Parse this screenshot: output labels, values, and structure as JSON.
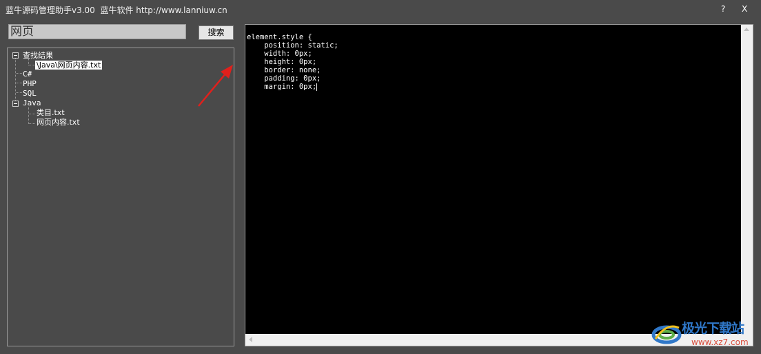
{
  "window": {
    "title": "蓝牛源码管理助手v3.00  蓝牛软件 http://www.lanniuw.cn",
    "help_label": "?",
    "close_label": "X"
  },
  "search": {
    "value": "网页",
    "button_label": "搜索"
  },
  "tree": {
    "nodes": [
      {
        "label": "查找结果"
      },
      {
        "label": "\\Java\\网页内容.txt"
      },
      {
        "label": "C#"
      },
      {
        "label": "PHP"
      },
      {
        "label": "SQL"
      },
      {
        "label": "Java"
      },
      {
        "label": "类目.txt"
      },
      {
        "label": "网页内容.txt"
      }
    ],
    "selected": "\\Java\\网页内容.txt"
  },
  "editor": {
    "content": "element.style {\n    position: static;\n    width: 0px;\n    height: 0px;\n    border: none;\n    padding: 0px;\n    margin: 0px;"
  },
  "watermark": {
    "title": "极光下载站",
    "url": "www.xz7.com"
  },
  "colors": {
    "background": "#4a4a4a",
    "editor_bg": "#000000",
    "annotation_arrow": "#e0201c",
    "watermark_blue": "#2f77c8",
    "watermark_red": "#d84c3b"
  },
  "icons": {
    "collapse": "minus-box-icon",
    "annotation": "red-arrow-icon",
    "watermark_logo": "swirl-logo-icon"
  }
}
